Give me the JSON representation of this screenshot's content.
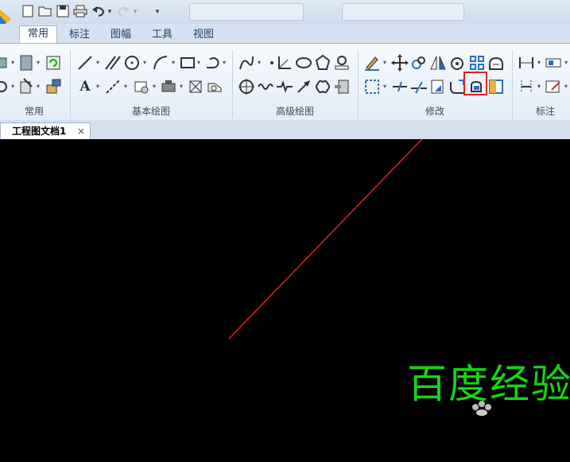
{
  "quick_access": {
    "icons": [
      "new-file-icon",
      "open-file-icon",
      "save-icon",
      "print-icon",
      "undo-icon",
      "redo-icon",
      "customize-icon"
    ],
    "chevron": "▾"
  },
  "ribbon_tabs": [
    {
      "label": "常用",
      "active": true
    },
    {
      "label": "标注",
      "active": false
    },
    {
      "label": "图幅",
      "active": false
    },
    {
      "label": "工具",
      "active": false
    },
    {
      "label": "视图",
      "active": false
    }
  ],
  "ribbon_groups": {
    "changyong": "常用",
    "jiben": "基本绘图",
    "gaoji": "高级绘图",
    "xiugai": "修改",
    "biaozhu": "标注"
  },
  "document_tab": {
    "label": "工程图文档1",
    "close": "×"
  },
  "watermark": {
    "text": "百度经验"
  },
  "colors": {
    "arrow": "#e02020",
    "watermark": "#16d416",
    "highlight": "#e02020",
    "canvas": "#000000"
  }
}
